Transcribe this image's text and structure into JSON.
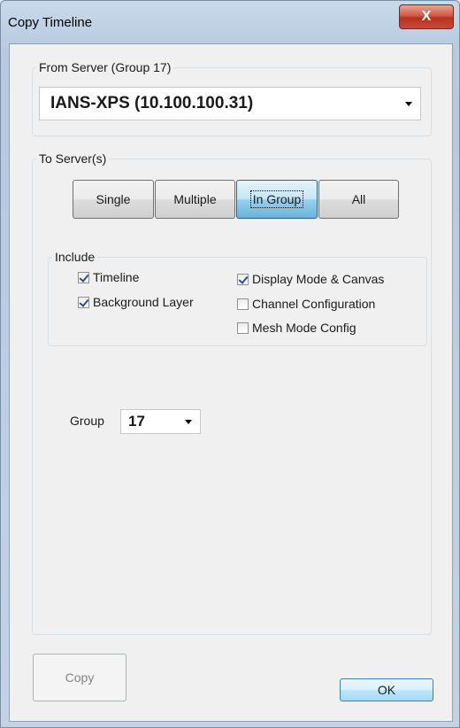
{
  "window": {
    "title": "Copy Timeline",
    "close_label": "X"
  },
  "from_server": {
    "legend": "From Server  (Group 17)",
    "selected": "IANS-XPS  (10.100.100.31)"
  },
  "to_servers": {
    "legend": "To Server(s)",
    "modes": [
      {
        "label": "Single",
        "active": false
      },
      {
        "label": "Multiple",
        "active": false
      },
      {
        "label": "In Group",
        "active": true
      },
      {
        "label": "All",
        "active": false
      }
    ]
  },
  "include": {
    "legend": "Include",
    "options": [
      {
        "label": "Timeline",
        "checked": true
      },
      {
        "label": "Background Layer",
        "checked": true
      },
      {
        "label": "Display Mode & Canvas",
        "checked": true
      },
      {
        "label": "Channel Configuration",
        "checked": false
      },
      {
        "label": "Mesh Mode Config",
        "checked": false
      }
    ]
  },
  "group_select": {
    "label": "Group",
    "value": "17"
  },
  "footer": {
    "copy_label": "Copy",
    "ok_label": "OK"
  }
}
